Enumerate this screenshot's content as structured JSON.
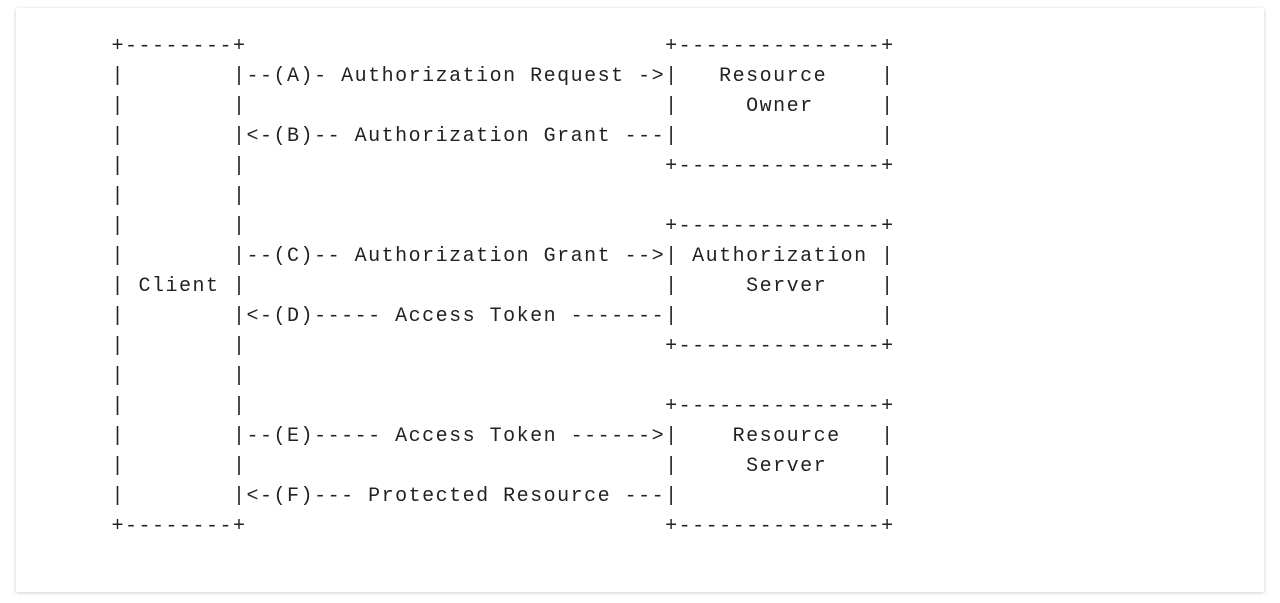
{
  "diagram": {
    "boxes": {
      "client": "Client",
      "resource_owner_l1": "Resource",
      "resource_owner_l2": "Owner",
      "auth_server_l1": "Authorization",
      "auth_server_l2": "Server",
      "resource_server_l1": "Resource",
      "resource_server_l2": "Server"
    },
    "flows": {
      "a": {
        "label": "(A)",
        "text": "Authorization Request",
        "dir": "->"
      },
      "b": {
        "label": "(B)",
        "text": "Authorization Grant",
        "dir": "<-"
      },
      "c": {
        "label": "(C)",
        "text": "Authorization Grant",
        "dir": "-->"
      },
      "d": {
        "label": "(D)",
        "text": "Access Token",
        "dir": "<-"
      },
      "e": {
        "label": "(E)",
        "text": "Access Token",
        "dir": "------>"
      },
      "f": {
        "label": "(F)",
        "text": "Protected Resource",
        "dir": "<-"
      }
    }
  }
}
